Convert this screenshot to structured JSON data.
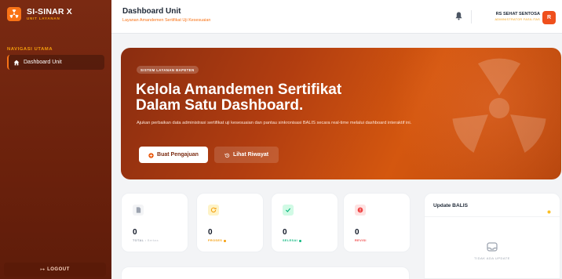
{
  "brand": {
    "name": "SI-SINAR X",
    "subtitle": "UNIT LAYANAN"
  },
  "sidebar": {
    "heading": "NAVIGASI UTAMA",
    "items": [
      {
        "label": "Dashboard Unit",
        "icon": "home-icon",
        "active": true
      }
    ],
    "logout": "LOGOUT"
  },
  "header": {
    "title": "Dashboard Unit",
    "subtitle": "Layanan Amandemen Sertifikat Uji Kesesuaian",
    "user_name": "RS SEHAT SENTOSA",
    "user_role": "ADMINISTRATOR FASILITAS",
    "avatar": "R"
  },
  "hero": {
    "badge": "SISTEM LAYANAN BAPETEN",
    "title_line1": "Kelola Amandemen Sertifikat",
    "title_line2": "Dalam Satu Dashboard.",
    "description": "Ajukan perbaikan data administrasi sertifikat uji kesesuaian dan pantau sinkronisasi BALIS secara real-time melalui dashboard interaktif ini.",
    "primary_button": "Buat Pengajuan",
    "secondary_button": "Lihat Riwayat"
  },
  "stats": [
    {
      "value": "0",
      "label": "TOTAL",
      "note": "• Berkas",
      "color": "#9ca3af",
      "icon": "document-icon"
    },
    {
      "value": "0",
      "label": "PROSES",
      "note": "",
      "color": "#f59e0b",
      "icon": "refresh-icon"
    },
    {
      "value": "0",
      "label": "SELESAI",
      "note": "",
      "color": "#10b981",
      "icon": "check-icon"
    },
    {
      "value": "0",
      "label": "REVISI",
      "note": "",
      "color": "#ef4444",
      "icon": "alert-icon"
    }
  ],
  "updates": {
    "title": "Update BALIS",
    "empty_text": "TIDAK ADA UPDATE"
  },
  "colors": {
    "accent": "#f97316",
    "sidebar": "#6b210c",
    "hero": "#b13d10"
  }
}
